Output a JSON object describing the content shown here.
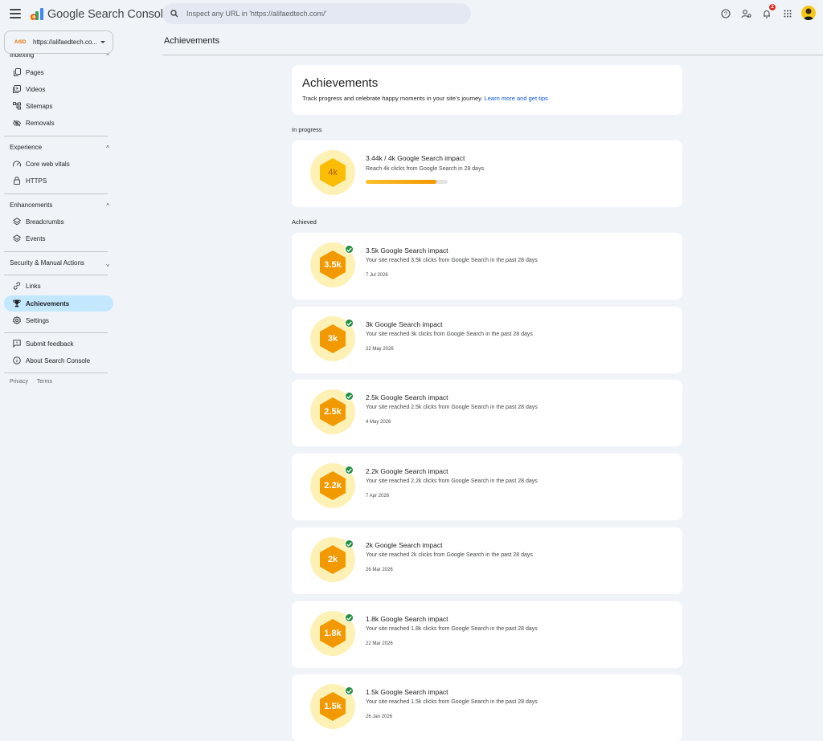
{
  "header": {
    "app_title": "Google Search Console",
    "search_placeholder": "Inspect any URL in 'https://alifaedtech.com/'",
    "notification_count": "2"
  },
  "property": {
    "abbrev": "AISD",
    "url": "https://alifaedtech.co..."
  },
  "sidebar": {
    "indexing_label": "Indexing",
    "indexing_items": [
      {
        "label": "Pages",
        "icon": "pages-icon"
      },
      {
        "label": "Videos",
        "icon": "videos-icon"
      },
      {
        "label": "Sitemaps",
        "icon": "sitemaps-icon"
      },
      {
        "label": "Removals",
        "icon": "removals-icon"
      }
    ],
    "experience_label": "Experience",
    "experience_items": [
      {
        "label": "Core web vitals",
        "icon": "gauge-icon"
      },
      {
        "label": "HTTPS",
        "icon": "lock-icon"
      }
    ],
    "enhancements_label": "Enhancements",
    "enhancements_items": [
      {
        "label": "Breadcrumbs",
        "icon": "layers-icon"
      },
      {
        "label": "Events",
        "icon": "layers-icon"
      }
    ],
    "security_label": "Security & Manual Actions",
    "misc_items": [
      {
        "label": "Links",
        "icon": "link-icon"
      },
      {
        "label": "Achievements",
        "icon": "trophy-icon"
      },
      {
        "label": "Settings",
        "icon": "gear-icon"
      }
    ],
    "support_items": [
      {
        "label": "Submit feedback",
        "icon": "feedback-icon"
      },
      {
        "label": "About Search Console",
        "icon": "info-icon"
      }
    ],
    "footer": {
      "privacy": "Privacy",
      "terms": "Terms"
    }
  },
  "main": {
    "page_title": "Achievements",
    "intro": {
      "title": "Achievements",
      "text": "Track progress and celebrate happy moments in your site's journey.",
      "link": "Learn more and get tips"
    },
    "in_progress_label": "In progress",
    "in_progress": {
      "badge": "4k",
      "title": "3.44k / 4k Google Search impact",
      "desc": "Reach 4k clicks from Google Search in 28 days",
      "progress": 0.86
    },
    "achieved_label": "Achieved",
    "achieved": [
      {
        "badge": "3.5k",
        "title": "3.5k Google Search impact",
        "desc": "Your site reached 3.5k clicks from Google Search in the past 28 days",
        "date": "7 Jul 2026"
      },
      {
        "badge": "3k",
        "title": "3k Google Search impact",
        "desc": "Your site reached 3k clicks from Google Search in the past 28 days",
        "date": "22 May 2026"
      },
      {
        "badge": "2.5k",
        "title": "2.5k Google Search impact",
        "desc": "Your site reached 2.5k clicks from Google Search in the past 28 days",
        "date": "4 May 2026"
      },
      {
        "badge": "2.2k",
        "title": "2.2k Google Search impact",
        "desc": "Your site reached 2.2k clicks from Google Search in the past 28 days",
        "date": "7 Apr 2026"
      },
      {
        "badge": "2k",
        "title": "2k Google Search impact",
        "desc": "Your site reached 2k clicks from Google Search in the past 28 days",
        "date": "26 Mar 2026"
      },
      {
        "badge": "1.8k",
        "title": "1.8k Google Search impact",
        "desc": "Your site reached 1.8k clicks from Google Search in the past 28 days",
        "date": "22 Mar 2026"
      },
      {
        "badge": "1.5k",
        "title": "1.5k Google Search impact",
        "desc": "Your site reached 1.5k clicks from Google Search in the past 28 days",
        "date": "26 Jan 2026"
      }
    ]
  },
  "colors": {
    "accent": "#0b57d0",
    "active_nav": "#c2e7ff",
    "medal_bg": "#fdf1b5",
    "hexagon": "#f29900",
    "hexagon_progress": "#fbbc04",
    "check": "#1e8e3e"
  }
}
